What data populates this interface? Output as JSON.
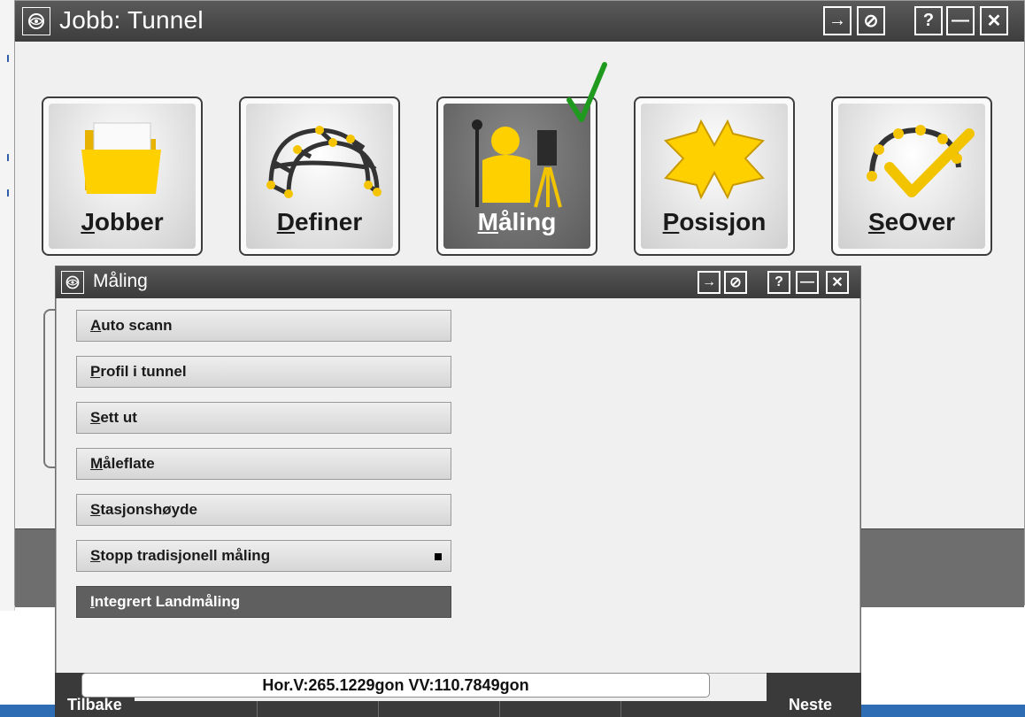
{
  "main_window": {
    "title": "Jobb: Tunnel",
    "titlebar_buttons": [
      "→",
      "⊘",
      "?",
      "—",
      "✕"
    ],
    "tiles": [
      {
        "underline": "J",
        "rest": "obber",
        "icon": "folder-icon",
        "active": false
      },
      {
        "underline": "D",
        "rest": "efiner",
        "icon": "tunnel-grid-icon",
        "active": false
      },
      {
        "underline": "M",
        "rest": "åling",
        "icon": "surveyor-instrument-icon",
        "active": true
      },
      {
        "underline": "P",
        "rest": "osisjon",
        "icon": "crossroad-arrows-icon",
        "active": false
      },
      {
        "underline": "S",
        "rest": "eOver",
        "icon": "tunnel-check-icon",
        "active": false
      }
    ]
  },
  "dialog": {
    "title": "Måling",
    "titlebar_buttons": [
      "→",
      "⊘",
      "?",
      "—",
      "✕"
    ],
    "menu_items": [
      {
        "underline": "A",
        "rest": "uto scann"
      },
      {
        "underline": "P",
        "rest": "rofil i tunnel"
      },
      {
        "underline": "S",
        "rest": "ett ut"
      },
      {
        "underline": "M",
        "rest": "åleflate"
      },
      {
        "underline": "S",
        "rest": "tasjonshøyde"
      },
      {
        "underline": "S",
        "rest": "topp tradisjonell måling"
      },
      {
        "underline": "I",
        "rest": "ntegrert Landmåling"
      }
    ],
    "status": "Hor.V:265.1229gon  VV:110.7849gon",
    "softkeys": {
      "back": "Tilbake",
      "next": "Neste"
    }
  },
  "colors": {
    "titlebar": "#3d3d3d",
    "accent_yellow": "#f2c400",
    "check_green": "#1f9a1f",
    "blue_bar": "#2e6db4"
  }
}
